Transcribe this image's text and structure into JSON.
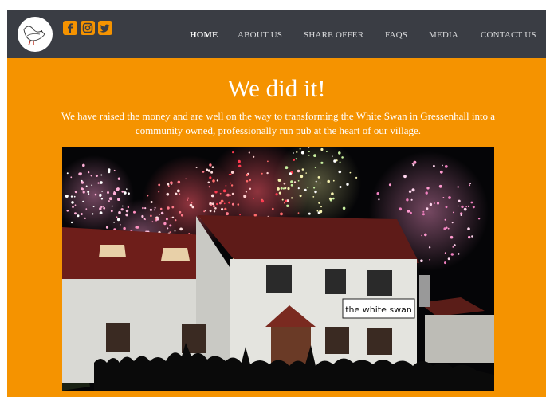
{
  "nav": {
    "items": [
      {
        "label": "HOME",
        "active": true
      },
      {
        "label": "ABOUT US",
        "active": false
      },
      {
        "label": "SHARE OFFER",
        "active": false
      },
      {
        "label": "FAQS",
        "active": false
      },
      {
        "label": "MEDIA",
        "active": false
      },
      {
        "label": "CONTACT US",
        "active": false
      }
    ],
    "social": [
      "facebook-icon",
      "instagram-icon",
      "twitter-icon"
    ]
  },
  "hero": {
    "title": "We did it!",
    "text": "We have raised the money and are well on the way to transforming the White Swan in Gressenhall into a community owned, professionally run pub at the heart of our village.",
    "pub_sign": "the white swan"
  },
  "colors": {
    "nav_bg": "#3a3d44",
    "accent": "#f59300",
    "nav_text": "#d9dadc",
    "white": "#ffffff"
  }
}
